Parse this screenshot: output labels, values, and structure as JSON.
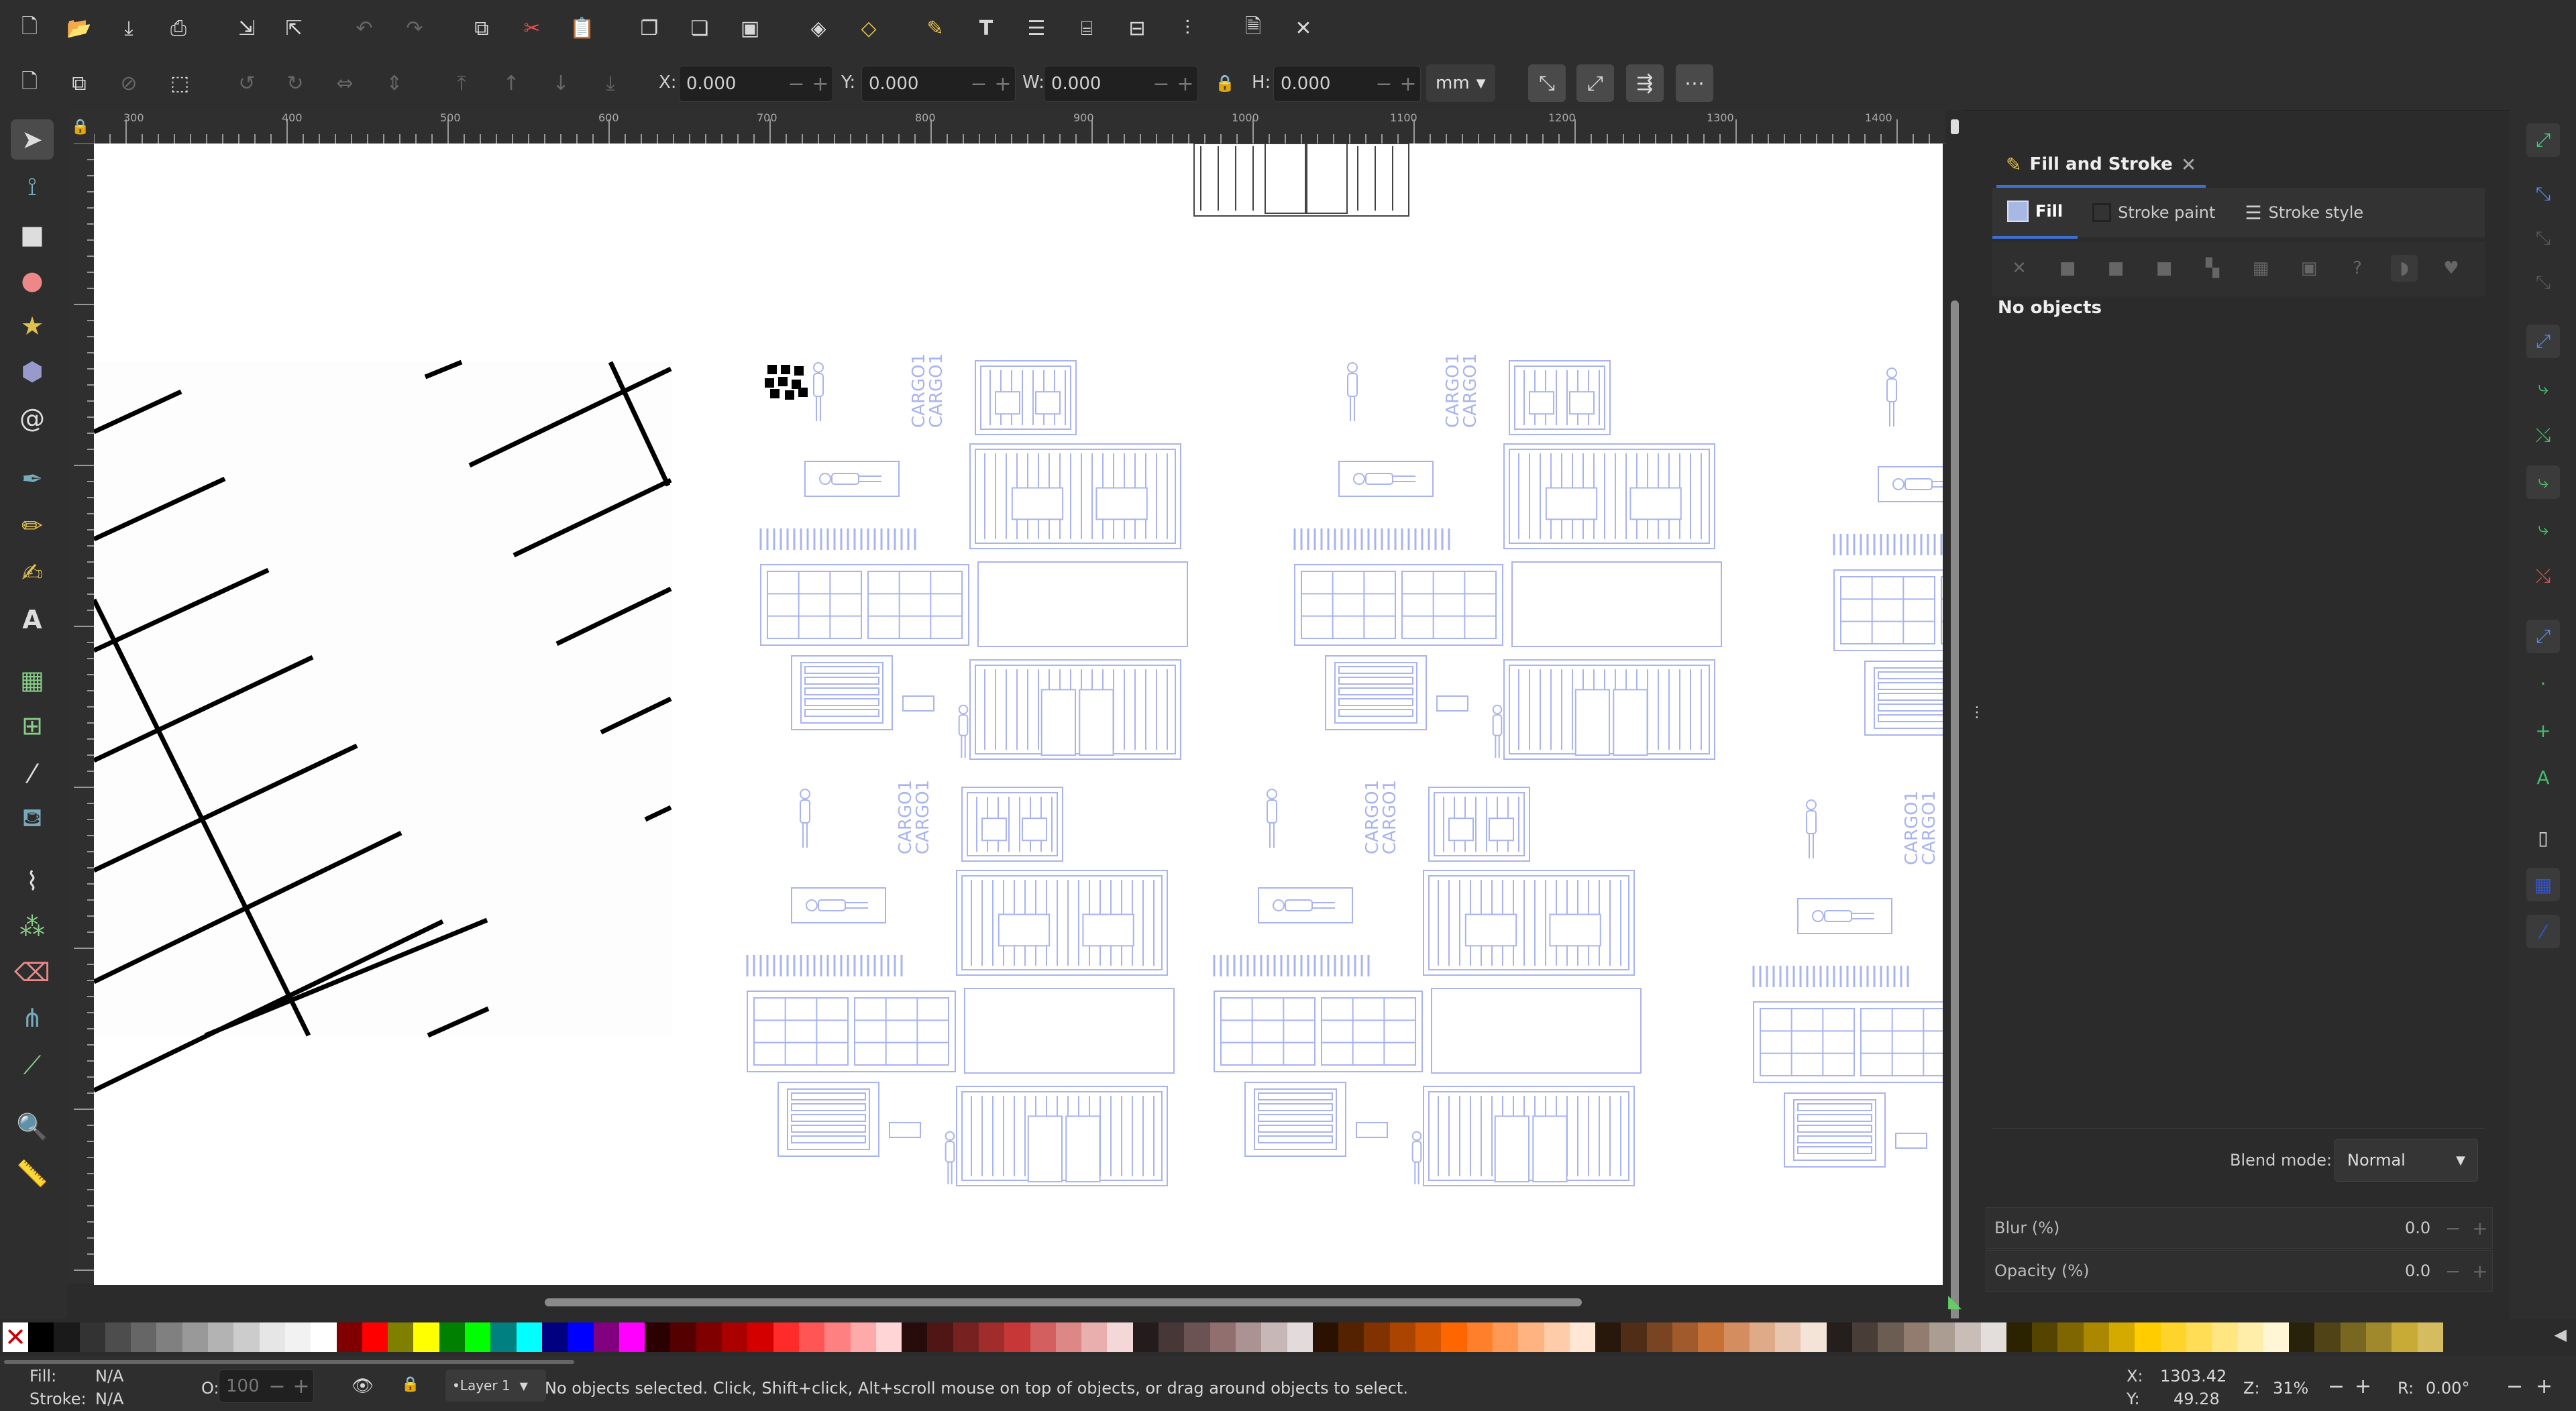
{
  "toolbar_controls": {
    "x_label": "X:",
    "x_value": "0.000",
    "y_label": "Y:",
    "y_value": "0.000",
    "w_label": "W:",
    "w_value": "0.000",
    "h_label": "H:",
    "h_value": "0.000",
    "unit": "mm"
  },
  "ruler": {
    "ticks": [
      "300",
      "400",
      "500",
      "600",
      "700",
      "800",
      "900",
      "1000",
      "1100",
      "1200",
      "1300",
      "1400"
    ]
  },
  "canvas": {
    "cargo_label": "CARGO1"
  },
  "dialog": {
    "title": "Fill and Stroke",
    "tabs": [
      "Fill",
      "Stroke paint",
      "Stroke style"
    ],
    "message": "No objects",
    "blend_label": "Blend mode:",
    "blend_value": "Normal",
    "blur_label": "Blur (%)",
    "blur_value": "0.0",
    "opacity_label": "Opacity (%)",
    "opacity_value": "0.0"
  },
  "status": {
    "fill_label": "Fill:",
    "fill_value": "N/A",
    "stroke_label": "Stroke:",
    "stroke_value": "N/A",
    "opacity_label": "O:",
    "opacity_value": "100",
    "layer": "•Layer 1",
    "message": "No objects selected. Click, Shift+click, Alt+scroll mouse on top of objects, or drag around objects to select.",
    "x_label": "X:",
    "x_value": "1303.42",
    "y_label": "Y:",
    "y_value": "49.28",
    "zoom_label": "Z:",
    "zoom_value": "31%",
    "rotation_label": "R:",
    "rotation_value": "0.00°"
  },
  "colors": {
    "accent": "#3d6fd1",
    "drawing_blue": "#a9b4ee"
  }
}
